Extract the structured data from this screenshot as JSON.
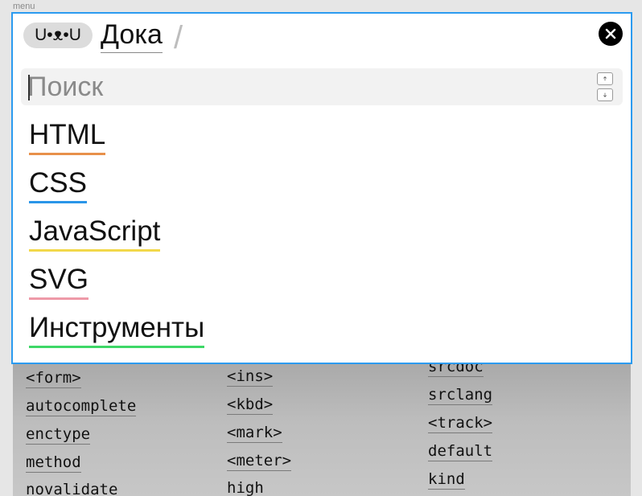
{
  "caption": "menu",
  "header": {
    "logo_text": "U•ᴥ•U",
    "brand": "Дока",
    "separator": "/"
  },
  "search": {
    "placeholder": "Поиск",
    "value": ""
  },
  "nav": [
    {
      "label": "HTML",
      "color": "#e8904a"
    },
    {
      "label": "CSS",
      "color": "#2a95e8"
    },
    {
      "label": "JavaScript",
      "color": "#f2d84a"
    },
    {
      "label": "SVG",
      "color": "#ee9aa8"
    },
    {
      "label": "Инструменты",
      "color": "#3ed867"
    }
  ],
  "background_columns": [
    [
      "<form>",
      "autocomplete",
      "enctype",
      "method",
      "novalidate"
    ],
    [
      "<ins>",
      "<kbd>",
      "<mark>",
      "<meter>",
      "high"
    ],
    [
      "srcdoc",
      "srclang",
      "<track>",
      "default",
      "kind"
    ]
  ],
  "colors": {
    "accent_border": "#2b9bf0"
  }
}
